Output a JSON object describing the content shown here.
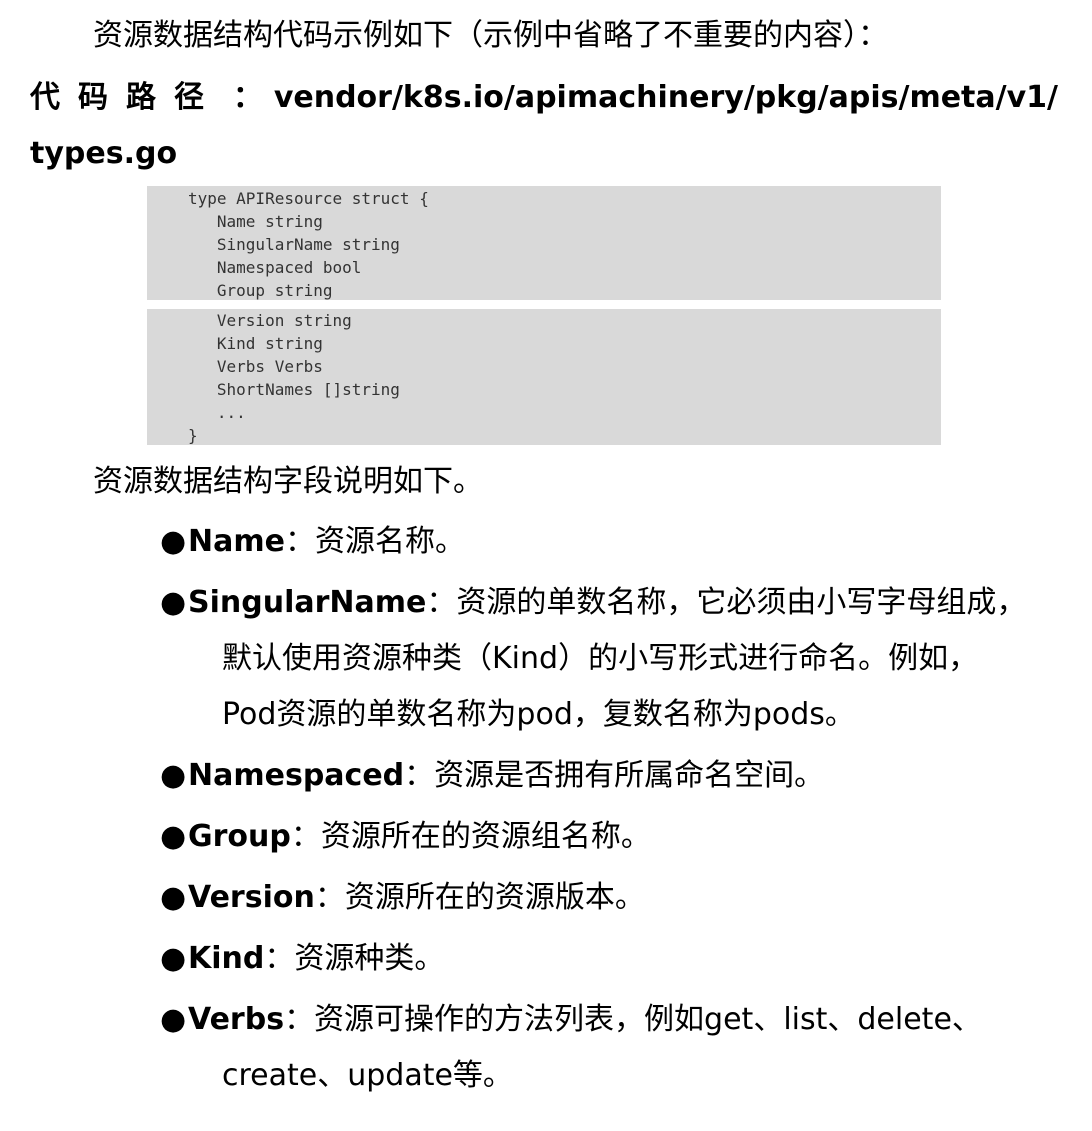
{
  "intro": "资源数据结构代码示例如下（示例中省略了不重要的内容）：",
  "path": {
    "label": "代码路径",
    "colon": "：",
    "value_line1": "vendor/k8s.io/apimachinery/pkg/apis/meta/v1/",
    "value_line2": "types.go"
  },
  "code_block_1": [
    "type APIResource struct {",
    "   Name string",
    "   SingularName string",
    "   Namespaced bool",
    "   Group string"
  ],
  "code_block_2": [
    "   Version string",
    "   Kind string",
    "   Verbs Verbs",
    "   ShortNames []string",
    "   ...",
    "}"
  ],
  "fields_title": "资源数据结构字段说明如下。",
  "bullet_glyph": "●",
  "fields": [
    {
      "name": "Name",
      "desc": "：资源名称。",
      "cont": []
    },
    {
      "name": "SingularName",
      "desc": "：资源的单数名称，它必须由小写字母组成，",
      "cont": [
        "默认使用资源种类（Kind）的小写形式进行命名。例如，",
        "Pod资源的单数名称为pod，复数名称为pods。"
      ]
    },
    {
      "name": "Namespaced",
      "desc": "：资源是否拥有所属命名空间。",
      "cont": []
    },
    {
      "name": "Group",
      "desc": "：资源所在的资源组名称。",
      "cont": []
    },
    {
      "name": "Version",
      "desc": "：资源所在的资源版本。",
      "cont": []
    },
    {
      "name": "Kind",
      "desc": "：资源种类。",
      "cont": []
    },
    {
      "name": "Verbs",
      "desc": "：资源可操作的方法列表，例如get、list、delete、",
      "cont": [
        "create、update等。"
      ]
    }
  ]
}
